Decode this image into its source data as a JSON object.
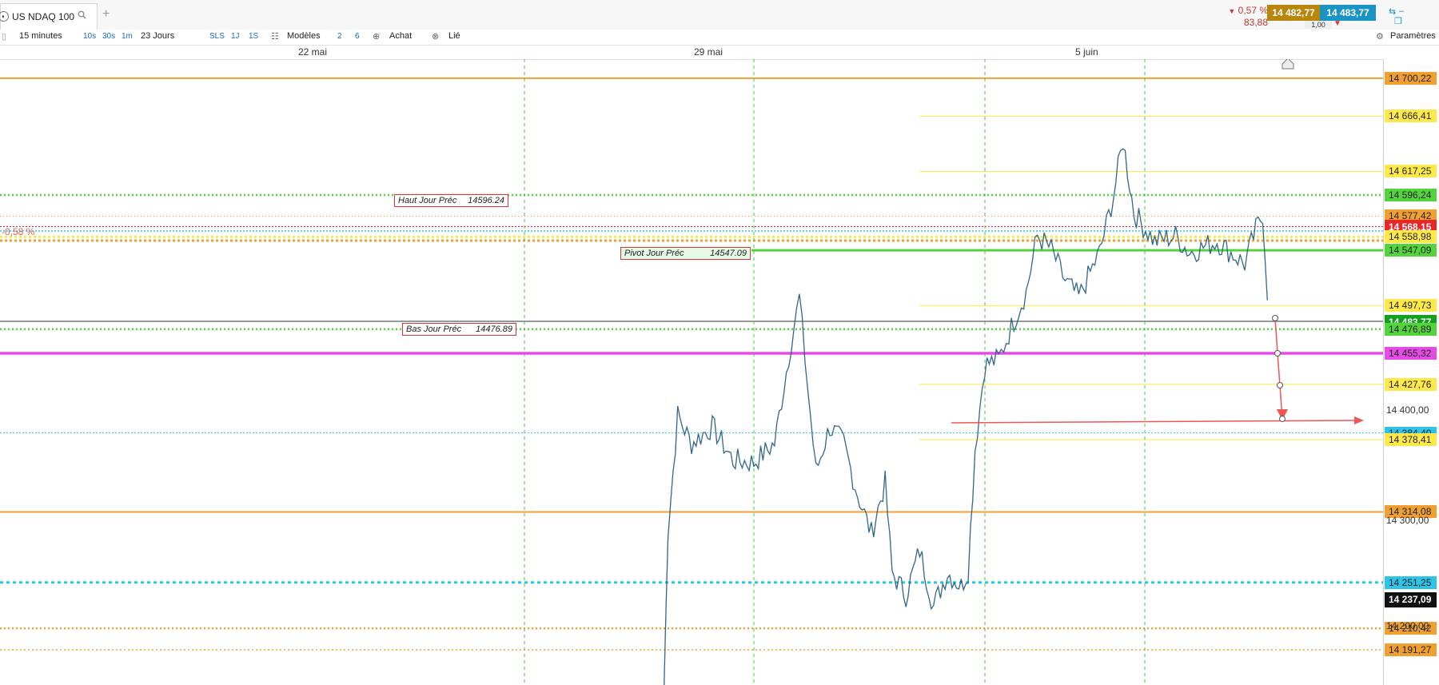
{
  "tab": {
    "title": "US NDAQ 100"
  },
  "quote": {
    "change_pct": "0,57 %",
    "change_pts": "83,88",
    "bid": "14 482,77",
    "ask": "14 483,77",
    "spread": "1,00"
  },
  "toolbar": {
    "interval": "15 minutes",
    "tf_10s": "10s",
    "tf_30s": "30s",
    "tf_1m": "1m",
    "period": "23 Jours",
    "sls": "SLS",
    "tf_1j": "1J",
    "tf_1s": "1S",
    "models": "Modèles",
    "n2": "2",
    "n6": "6",
    "buy": "Achat",
    "link": "Lié",
    "settings": "Paramètres"
  },
  "dates": [
    "22 mai",
    "29 mai",
    "5 juin"
  ],
  "chart_tags": {
    "pct": "-0,58 %",
    "haut_label": "Haut Jour Préc",
    "haut_value": "14596.24",
    "pivot_label": "Pivot Jour  Préc",
    "pivot_value": "14547.09",
    "bas_label": "Bas Jour Préc",
    "bas_value": "14476.89"
  },
  "chart_data": {
    "type": "line",
    "instrument": "US NDAQ 100",
    "interval": "15 minutes",
    "axis_labels": [
      "14 400,00",
      "14 300,00",
      "14 200,00"
    ],
    "levels": [
      {
        "value": "14 700,22",
        "color": "#f0a030"
      },
      {
        "value": "14 666,41",
        "color": "#ffe94a"
      },
      {
        "value": "14 617,25",
        "color": "#ffe94a"
      },
      {
        "value": "14 596,24",
        "color": "#54d43c"
      },
      {
        "value": "14 577,42",
        "color": "#f0a030"
      },
      {
        "value": "14 568,15",
        "color": "#e8262a"
      },
      {
        "value": "14 558,98",
        "color": "#ffe94a"
      },
      {
        "value": "14 547,09",
        "color": "#54d43c"
      },
      {
        "value": "14 497,73",
        "color": "#ffe94a"
      },
      {
        "value": "14 483,77",
        "color": "#12a01e"
      },
      {
        "value": "14 476,89",
        "color": "#54d43c"
      },
      {
        "value": "14 455,32",
        "color": "#e64be6"
      },
      {
        "value": "14 427,76",
        "color": "#ffe94a"
      },
      {
        "value": "14 384,40",
        "color": "#2ec4e8"
      },
      {
        "value": "14 378,41",
        "color": "#ffe94a"
      },
      {
        "value": "14 314,08",
        "color": "#f0a030"
      },
      {
        "value": "14 251,25",
        "color": "#2ec4e8"
      },
      {
        "value": "14 237,09",
        "color": "#111111"
      },
      {
        "value": "14 210,42",
        "color": "#f0a030"
      },
      {
        "value": "14 191,27",
        "color": "#f0a030"
      }
    ],
    "price_points": [
      [
        0.48,
        14150
      ],
      [
        0.483,
        14300
      ],
      [
        0.485,
        14325
      ],
      [
        0.49,
        14400
      ],
      [
        0.5,
        14375
      ],
      [
        0.515,
        14390
      ],
      [
        0.53,
        14360
      ],
      [
        0.545,
        14358
      ],
      [
        0.56,
        14375
      ],
      [
        0.572,
        14465
      ],
      [
        0.578,
        14505
      ],
      [
        0.584,
        14425
      ],
      [
        0.59,
        14350
      ],
      [
        0.6,
        14390
      ],
      [
        0.61,
        14375
      ],
      [
        0.62,
        14330
      ],
      [
        0.63,
        14295
      ],
      [
        0.64,
        14340
      ],
      [
        0.645,
        14260
      ],
      [
        0.655,
        14240
      ],
      [
        0.665,
        14280
      ],
      [
        0.675,
        14230
      ],
      [
        0.685,
        14260
      ],
      [
        0.695,
        14248
      ],
      [
        0.7,
        14262
      ],
      [
        0.705,
        14370
      ],
      [
        0.712,
        14445
      ],
      [
        0.722,
        14450
      ],
      [
        0.735,
        14490
      ],
      [
        0.742,
        14510
      ],
      [
        0.75,
        14560
      ],
      [
        0.76,
        14548
      ],
      [
        0.77,
        14520
      ],
      [
        0.78,
        14505
      ],
      [
        0.795,
        14545
      ],
      [
        0.805,
        14595
      ],
      [
        0.812,
        14645
      ],
      [
        0.82,
        14580
      ],
      [
        0.835,
        14555
      ],
      [
        0.85,
        14560
      ],
      [
        0.86,
        14545
      ],
      [
        0.87,
        14550
      ],
      [
        0.88,
        14555
      ],
      [
        0.89,
        14545
      ],
      [
        0.9,
        14535
      ],
      [
        0.908,
        14565
      ],
      [
        0.913,
        14580
      ],
      [
        0.918,
        14476
      ]
    ]
  }
}
